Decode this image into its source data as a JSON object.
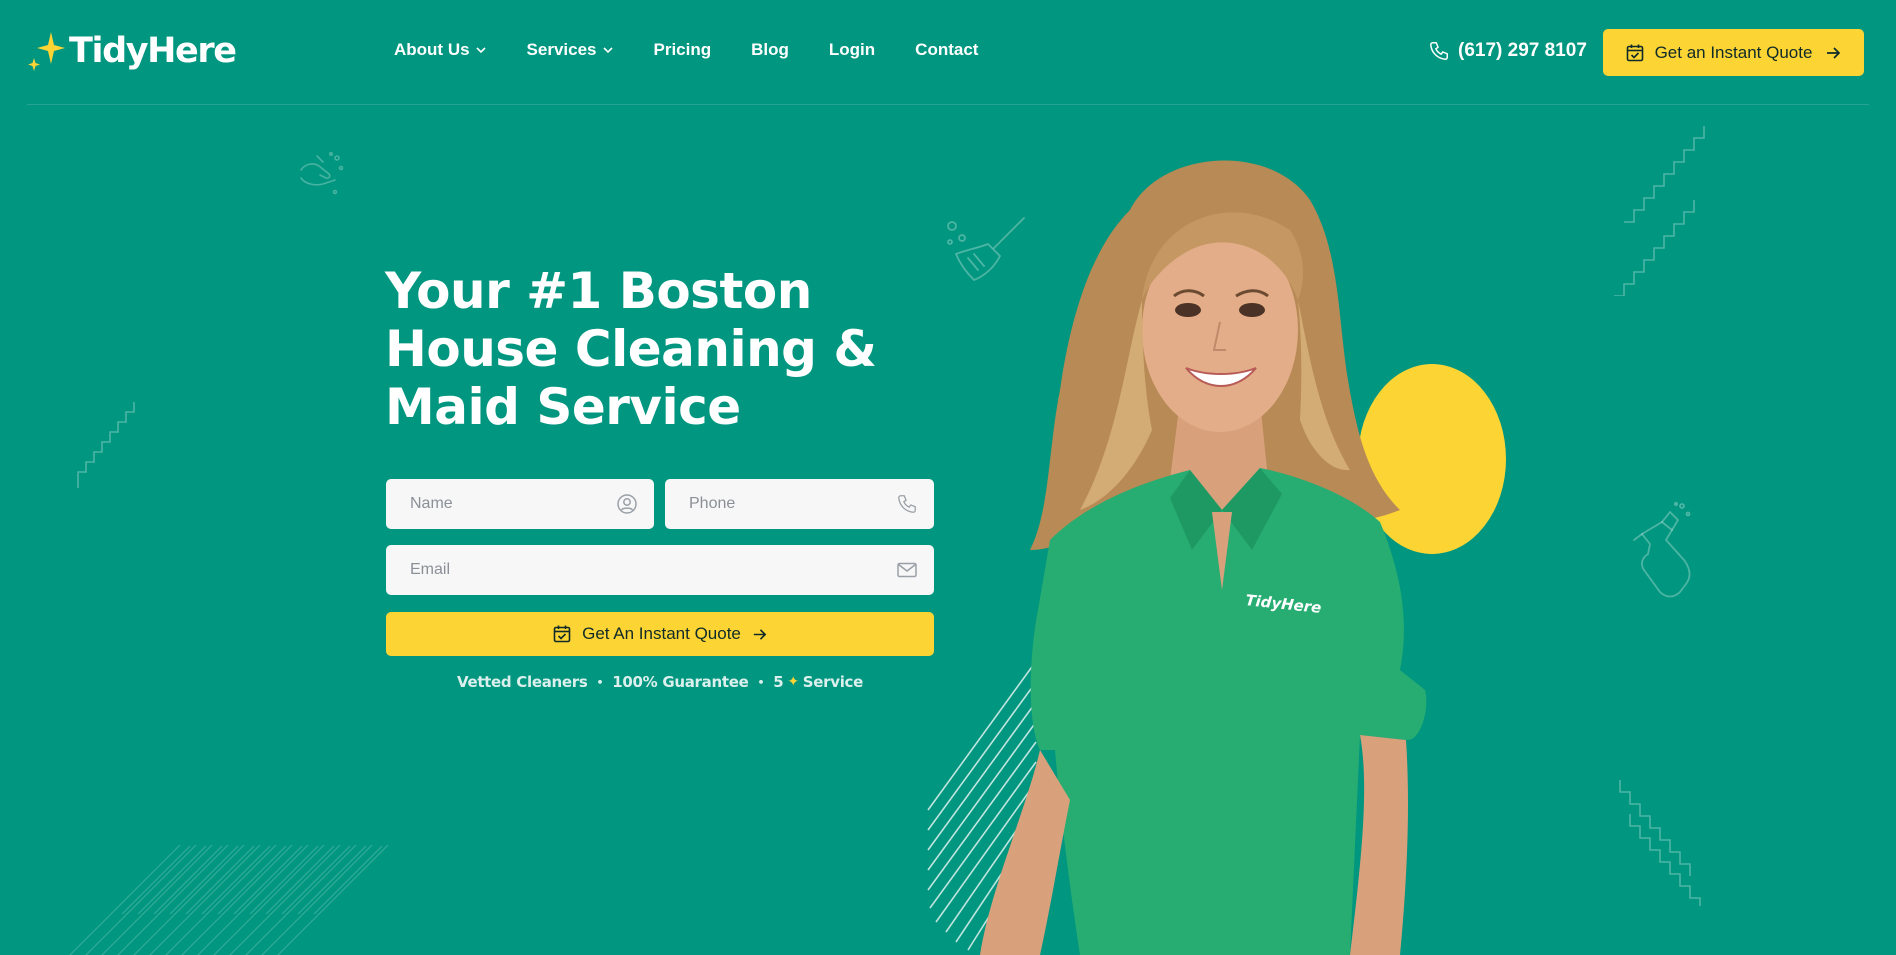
{
  "brand": {
    "name": "TidyHere",
    "accent": "#fcd535",
    "background": "#01967f"
  },
  "nav": {
    "items": [
      {
        "label": "About Us",
        "has_dropdown": true
      },
      {
        "label": "Services",
        "has_dropdown": true
      },
      {
        "label": "Pricing",
        "has_dropdown": false
      },
      {
        "label": "Blog",
        "has_dropdown": false
      },
      {
        "label": "Login",
        "has_dropdown": false
      },
      {
        "label": "Contact",
        "has_dropdown": false
      }
    ]
  },
  "header": {
    "phone": "(617) 297 8107",
    "quote_button": "Get an Instant Quote"
  },
  "hero": {
    "title_line1": "Your #1 Boston",
    "title_line2": "House Cleaning &",
    "title_line3": "Maid Service"
  },
  "form": {
    "name_placeholder": "Name",
    "phone_placeholder": "Phone",
    "email_placeholder": "Email",
    "submit_label": "Get An Instant Quote"
  },
  "trust": {
    "item1": "Vetted Cleaners",
    "item2": "100% Guarantee",
    "item3_prefix": "5",
    "item3_suffix": "Service"
  },
  "shirt_logo": "TidyHere"
}
